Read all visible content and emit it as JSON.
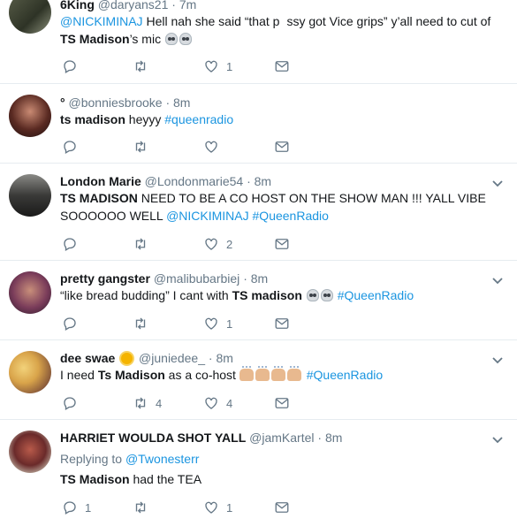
{
  "colors": {
    "link": "#1b95e0",
    "muted": "#657786",
    "text": "#14171a",
    "border": "#e6ecf0"
  },
  "tweets": [
    {
      "name": "6King",
      "handle": "@daryans21",
      "sep": "·",
      "time": "7m",
      "text": {
        "mention": "@NICKIMINAJ",
        "t1": " Hell nah she said “that p",
        "t2": "ssy got Vice grips” y’all need to cut of ",
        "bold": "TS Madison",
        "t3": "’s mic "
      },
      "actions": {
        "reply": "",
        "retweet": "",
        "like": "1"
      }
    },
    {
      "name": "°",
      "handle": "@bonniesbrooke",
      "sep": "·",
      "time": "8m",
      "text": {
        "bold": "ts madison",
        "t1": " heyyy ",
        "hashtag": "#queenradio"
      },
      "actions": {
        "reply": "",
        "retweet": "",
        "like": ""
      }
    },
    {
      "name": "London Marie",
      "handle": "@Londonmarie54",
      "sep": "·",
      "time": "8m",
      "text": {
        "bold": "TS MADISON",
        "t1": " NEED TO BE A CO HOST ON THE SHOW MAN !!! YALL VIBE SOOOOOO WELL ",
        "mention": "@NICKIMINAJ",
        "t2": " ",
        "hashtag": "#QueenRadio"
      },
      "actions": {
        "reply": "",
        "retweet": "",
        "like": "2"
      }
    },
    {
      "name": "pretty gangster",
      "handle": "@malibubarbiej",
      "sep": "·",
      "time": "8m",
      "text": {
        "t1": "“like bread budding” I cant with ",
        "bold": "TS madison",
        "t2": " ",
        "hashtag": "#QueenRadio"
      },
      "actions": {
        "reply": "",
        "retweet": "",
        "like": "1"
      }
    },
    {
      "name": "dee swae",
      "handle": "@juniedee_",
      "sep": "·",
      "time": "8m",
      "text": {
        "t1": "I need ",
        "bold": "Ts Madison",
        "t2": " as a co-host ",
        "hashtag": "#QueenRadio"
      },
      "actions": {
        "reply": "",
        "retweet": "4",
        "like": "4"
      }
    },
    {
      "name": "HARRIET WOULDA SHOT YALL",
      "handle": "@jamKartel",
      "sep": "·",
      "time": "8m",
      "reply_label": "Replying to ",
      "reply_to": "@Twonesterr",
      "text": {
        "bold": "TS Madison",
        "t1": " had the TEA"
      },
      "actions": {
        "reply": "1",
        "retweet": "",
        "like": "1"
      }
    }
  ]
}
